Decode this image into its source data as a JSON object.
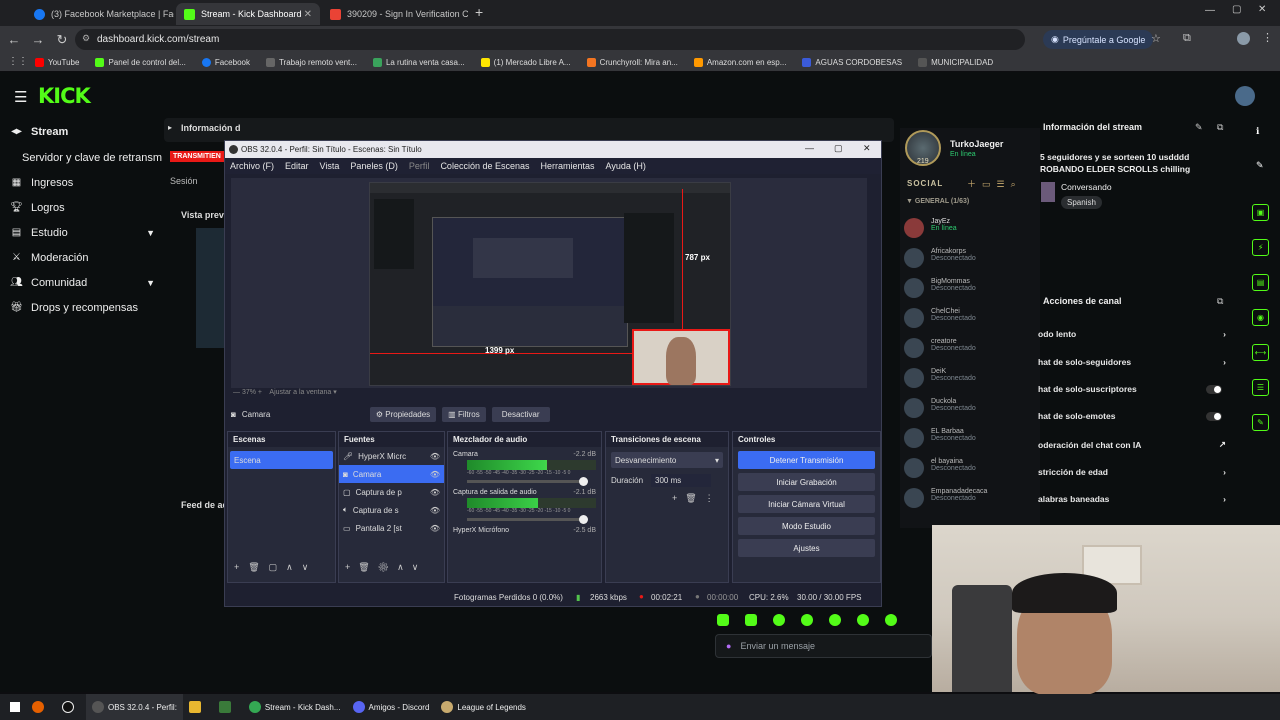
{
  "tabs": [
    {
      "label": "(3) Facebook Marketplace | Face",
      "icon": "facebook-icon"
    },
    {
      "label": "Stream - Kick Dashboard",
      "icon": "kick-icon"
    },
    {
      "label": "390209 - Sign In Verification Co",
      "icon": "gmail-icon"
    }
  ],
  "address": {
    "url": "dashboard.kick.com/stream",
    "google_button": "Pregúntale a Google"
  },
  "bookmarks": [
    "YouTube",
    "Panel de control del...",
    "Facebook",
    "Trabajo remoto vent...",
    "La rutina venta casa...",
    "(1) Mercado Libre A...",
    "Crunchyroll: Mira an...",
    "Amazon.com en esp...",
    "AGUAS CORDOBESAS",
    "MUNICIPALIDAD"
  ],
  "kick": {
    "logo": "KICK",
    "sidebar": [
      {
        "label": "Stream",
        "icon": "video-icon"
      },
      {
        "label": "Servidor y clave de retransm",
        "icon": ""
      },
      {
        "label": "Ingresos",
        "icon": "grid-icon"
      },
      {
        "label": "Logros",
        "icon": "trophy-icon"
      },
      {
        "label": "Estudio",
        "icon": "layout-icon"
      },
      {
        "label": "Moderación",
        "icon": "sword-icon"
      },
      {
        "label": "Comunidad",
        "icon": "people-icon"
      },
      {
        "label": "Drops y recompensas",
        "icon": "gift-icon"
      }
    ],
    "panels": {
      "info": "Información d",
      "live_badge": "TRANSMITIEN",
      "session": "Sesión",
      "preview": "Vista prev",
      "feed": "Feed de ac"
    }
  },
  "obs": {
    "title": "OBS 32.0.4 - Perfil: Sin Título - Escenas: Sin Título",
    "menu": [
      "Archivo (F)",
      "Editar",
      "Vista",
      "Paneles (D)",
      "Perfil",
      "Colección de Escenas",
      "Herramientas",
      "Ayuda (H)"
    ],
    "preview": {
      "measure_v": "787 px",
      "measure_h": "1399 px",
      "zoom": "37%",
      "fit": "Ajustar a la ventana"
    },
    "source_bar": {
      "selected": "Camara",
      "props": "Propiedades",
      "filters": "Filtros",
      "disable": "Desactivar"
    },
    "scenes": {
      "title": "Escenas",
      "items": [
        "Escena"
      ]
    },
    "sources": {
      "title": "Fuentes",
      "items": [
        "HyperX Micrc",
        "Camara",
        "Captura de p",
        "Captura de s",
        "Pantalla 2 [st"
      ]
    },
    "mixer": {
      "title": "Mezclador de audio",
      "channels": [
        {
          "name": "Camara",
          "db": "-2.2 dB",
          "level": 0.62
        },
        {
          "name": "Captura de salida de audio",
          "db": "-2.1 dB",
          "level": 0.55
        },
        {
          "name": "HyperX Micrófono",
          "db": "-2.5 dB",
          "level": 0.4
        }
      ],
      "scale": "-60 -55 -50 -45 -40 -35 -30 -25 -20 -15 -10 -5 0"
    },
    "transitions": {
      "title": "Transiciones de escena",
      "type": "Desvanecimiento",
      "duration_label": "Duración",
      "duration": "300 ms"
    },
    "controls": {
      "title": "Controles",
      "buttons": [
        "Detener Transmisión",
        "Iniciar Grabación",
        "Iniciar Cámara Virtual",
        "Modo Estudio",
        "Ajustes"
      ]
    },
    "status": {
      "dropped": "Fotogramas Perdidos 0 (0.0%)",
      "kbps": "2663 kbps",
      "live_time": "00:02:21",
      "rec_time": "00:00:00",
      "cpu": "CPU: 2.6%",
      "fps": "30.00 / 30.00 FPS"
    }
  },
  "social": {
    "user": "TurkoJaeger",
    "user_status": "En línea",
    "level": "219",
    "section": "SOCIAL",
    "group": "GENERAL (1/63)",
    "friends": [
      {
        "name": "JayEz",
        "status": "En línea"
      },
      {
        "name": "Africakorps",
        "status": "Desconectado"
      },
      {
        "name": "BigMommas",
        "status": "Desconectado"
      },
      {
        "name": "ChelChei",
        "status": "Desconectado"
      },
      {
        "name": "creatore",
        "status": "Desconectado"
      },
      {
        "name": "DeiK",
        "status": "Desconectado"
      },
      {
        "name": "Duckola",
        "status": "Desconectado"
      },
      {
        "name": "EL Barbaa",
        "status": "Desconectado"
      },
      {
        "name": "el bayaina",
        "status": "Desconectado"
      },
      {
        "name": "Empanadadecaca",
        "status": "Desconectado"
      }
    ]
  },
  "stream_info": {
    "title": "Información del stream",
    "text_line1": "5 seguidores y se sorteen 10 usdddd",
    "text_line2": "ROBANDO ELDER SCROLLS chilling",
    "category": "Conversando",
    "language": "Spanish"
  },
  "channel_actions": {
    "title": "Acciones de canal",
    "items": [
      {
        "label": "odo lento",
        "control": "chevron"
      },
      {
        "label": "hat de solo-seguidores",
        "control": "chevron"
      },
      {
        "label": "hat de solo-suscriptores",
        "control": "toggle"
      },
      {
        "label": "hat de solo-emotes",
        "control": "toggle"
      },
      {
        "label": "oderación del chat con IA",
        "control": "link"
      },
      {
        "label": "stricción de edad",
        "control": "chevron"
      },
      {
        "label": "alabras baneadas",
        "control": "chevron"
      }
    ]
  },
  "chat": {
    "placeholder": "Enviar un mensaje"
  },
  "taskbar": [
    {
      "label": "OBS 32.0.4 - Perfil:",
      "icon": "obs-icon"
    },
    {
      "label": "Stream - Kick Dash...",
      "icon": "chrome-icon"
    },
    {
      "label": "Amigos - Discord",
      "icon": "discord-icon"
    },
    {
      "label": "League of Legends",
      "icon": "lol-icon"
    }
  ],
  "colors": {
    "kick_green": "#53fc18",
    "obs_accent": "#3b6cf2",
    "live_red": "#e91916"
  }
}
